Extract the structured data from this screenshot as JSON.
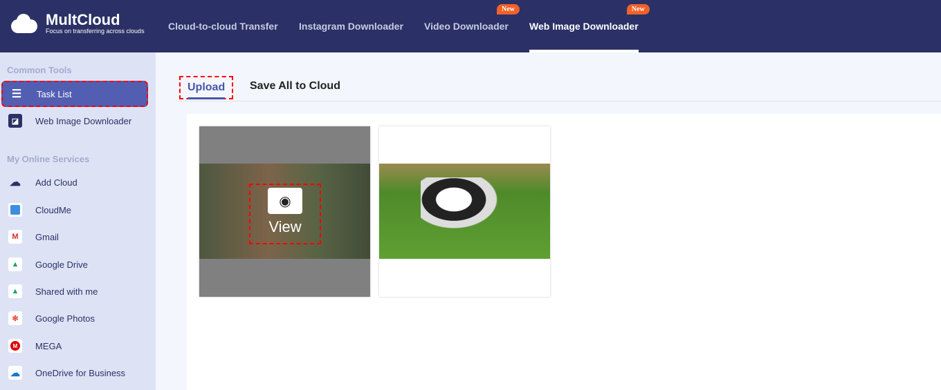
{
  "header": {
    "brand": "MultCloud",
    "tagline": "Focus on transferring across clouds",
    "nav": [
      {
        "label": "Cloud-to-cloud Transfer"
      },
      {
        "label": "Instagram Downloader"
      },
      {
        "label": "Video Downloader",
        "badge": "New"
      },
      {
        "label": "Web Image Downloader",
        "badge": "New"
      }
    ]
  },
  "sidebar": {
    "common_title": "Common Tools",
    "common": [
      {
        "label": "Task List"
      },
      {
        "label": "Web Image Downloader"
      }
    ],
    "services_title": "My Online Services",
    "services": [
      {
        "label": "Add Cloud"
      },
      {
        "label": "CloudMe"
      },
      {
        "label": "Gmail"
      },
      {
        "label": "Google Drive"
      },
      {
        "label": "Shared with me"
      },
      {
        "label": "Google Photos"
      },
      {
        "label": "MEGA"
      },
      {
        "label": "OneDrive for Business"
      }
    ]
  },
  "main": {
    "tabs": [
      {
        "label": "Upload"
      },
      {
        "label": "Save All to Cloud"
      }
    ],
    "view_label": "View"
  }
}
